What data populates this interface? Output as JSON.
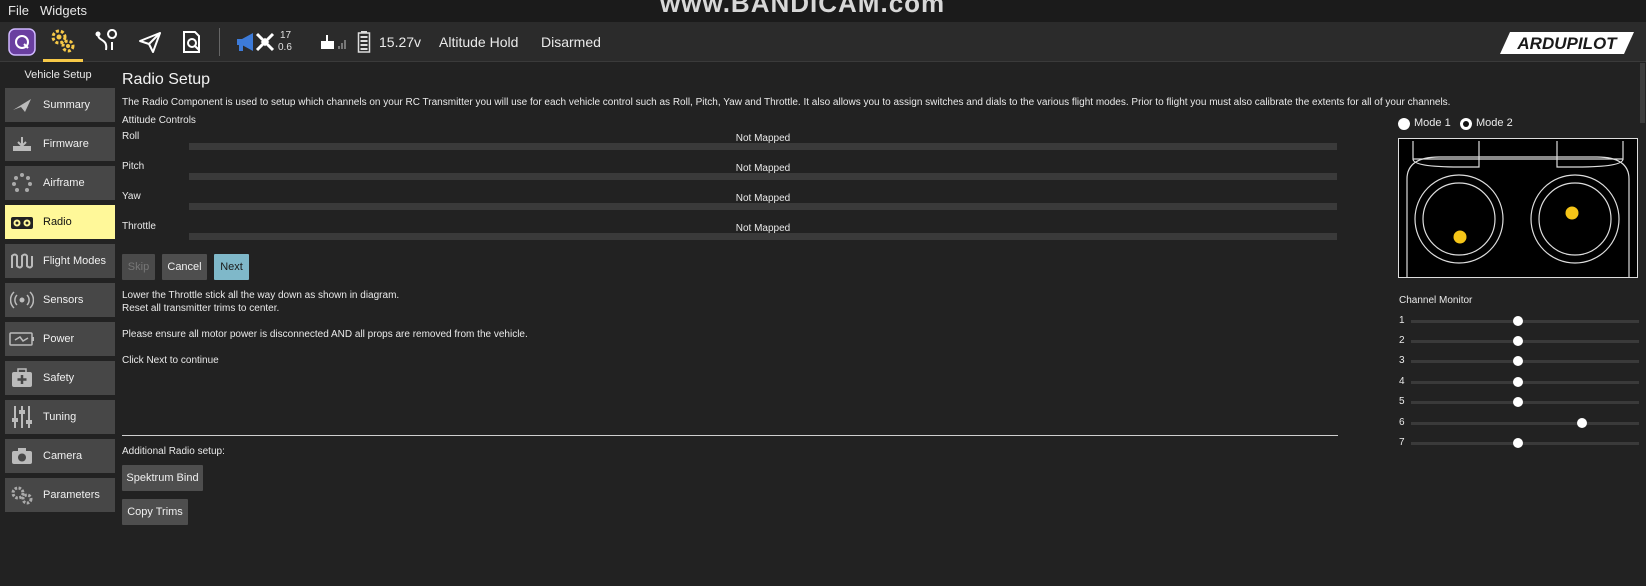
{
  "menu": {
    "file": "File",
    "widgets": "Widgets"
  },
  "watermark": "www.BANDICAM.com",
  "toolbar": {
    "gps_count": "17",
    "gps_hdop": "0.6",
    "battery": "15.27v",
    "flight_mode": "Altitude Hold",
    "armed_state": "Disarmed",
    "logo": "ARDUPILOT",
    "accent_color": "#f7c948"
  },
  "sidebar": {
    "title": "Vehicle Setup",
    "items": [
      {
        "label": "Summary",
        "icon": "plane-icon"
      },
      {
        "label": "Firmware",
        "icon": "download-icon"
      },
      {
        "label": "Airframe",
        "icon": "dots-circle-icon"
      },
      {
        "label": "Radio",
        "icon": "radio-icon"
      },
      {
        "label": "Flight Modes",
        "icon": "wave-icon"
      },
      {
        "label": "Sensors",
        "icon": "sensors-icon"
      },
      {
        "label": "Power",
        "icon": "battery-icon"
      },
      {
        "label": "Safety",
        "icon": "medkit-icon"
      },
      {
        "label": "Tuning",
        "icon": "sliders-icon"
      },
      {
        "label": "Camera",
        "icon": "camera-icon"
      },
      {
        "label": "Parameters",
        "icon": "gears-icon"
      }
    ],
    "active": "Radio"
  },
  "main": {
    "title": "Radio Setup",
    "description": "The Radio Component is used to setup which channels on your RC Transmitter you will use for each vehicle control such as Roll, Pitch, Yaw and Throttle. It also allows you to assign switches and dials to the various flight modes. Prior to flight you must also calibrate the extents for all of your channels.",
    "attitude_title": "Attitude Controls",
    "controls": [
      {
        "name": "Roll",
        "value": "Not Mapped"
      },
      {
        "name": "Pitch",
        "value": "Not Mapped"
      },
      {
        "name": "Yaw",
        "value": "Not Mapped"
      },
      {
        "name": "Throttle",
        "value": "Not Mapped"
      }
    ],
    "buttons": {
      "skip": "Skip",
      "cancel": "Cancel",
      "next": "Next"
    },
    "instructions": {
      "line1": "Lower the Throttle stick all the way down as shown in diagram.",
      "line2": "Reset all transmitter trims to center.",
      "line3": "Please ensure all motor power is disconnected AND all props are removed from the vehicle.",
      "line4": "Click Next to continue"
    },
    "additional_title": "Additional Radio setup:",
    "spektrum_bind": "Spektrum Bind",
    "copy_trims": "Copy Trims"
  },
  "right_panel": {
    "mode1": "Mode 1",
    "mode2": "Mode 2",
    "selected_mode": "Mode 2",
    "channel_monitor_title": "Channel Monitor",
    "channels": [
      {
        "num": "1",
        "level": 0.47
      },
      {
        "num": "2",
        "level": 0.47
      },
      {
        "num": "3",
        "level": 0.47
      },
      {
        "num": "4",
        "level": 0.47
      },
      {
        "num": "5",
        "level": 0.47
      },
      {
        "num": "6",
        "level": 0.75
      },
      {
        "num": "7",
        "level": 0.47
      }
    ]
  }
}
